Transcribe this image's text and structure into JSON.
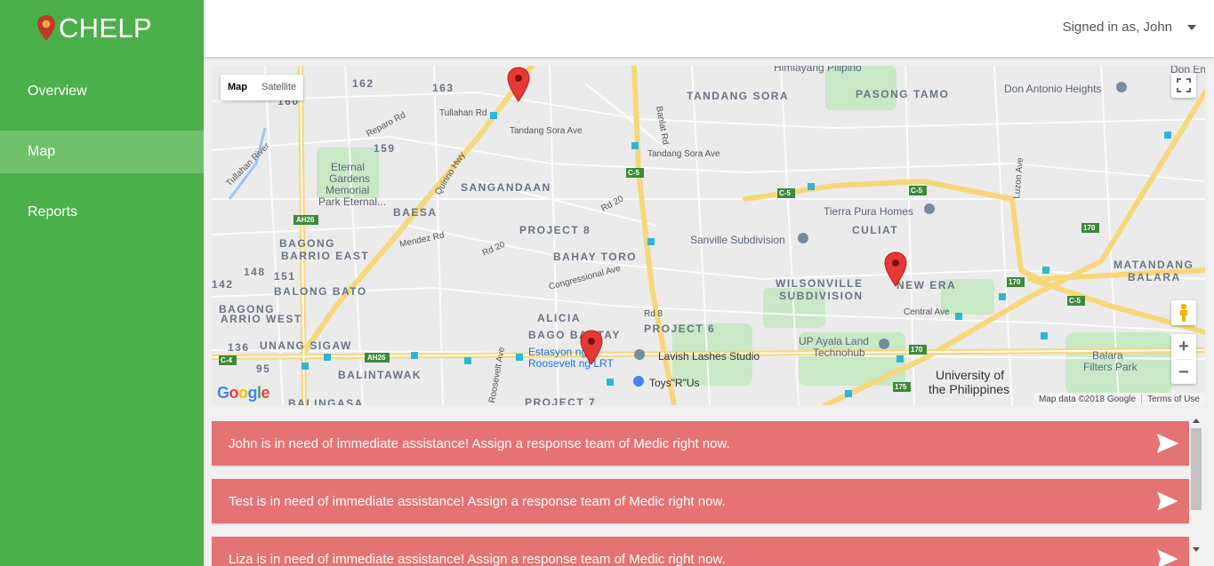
{
  "app": {
    "brand": "CHELP",
    "brand_color": "#4cb04a"
  },
  "sidebar": {
    "items": [
      {
        "label": "Overview",
        "active": false
      },
      {
        "label": "Map",
        "active": true
      },
      {
        "label": "Reports",
        "active": false
      }
    ]
  },
  "header": {
    "user_label": "Signed in as, John"
  },
  "map": {
    "type_map": "Map",
    "type_satellite": "Satellite",
    "attribution": "Map data ©2018 Google",
    "terms": "Terms of Use",
    "google_logo": "Google",
    "place_labels": [
      "162",
      "163",
      "160",
      "159",
      "148",
      "151",
      "142",
      "136",
      "95",
      "TANDANG SORA",
      "PASONG TAMO",
      "Don Antonio Heights",
      "Himlayang Pilipino",
      "Don Enriq",
      "SANGANDAAN",
      "BAESA",
      "BAGONG",
      "BARRIO EAST",
      "BALONG BATO",
      "BAGONG",
      "ARRIO WEST",
      "UNANG SIGAW",
      "BALINTAWAK",
      "BALINGASA",
      "PROJECT 8",
      "BAHAY TORO",
      "ALICIA",
      "BAGO BANTAY",
      "PROJECT 6",
      "PROJECT 7",
      "WILSONVILLE",
      "SUBDIVISION",
      "NEW ERA",
      "CULIAT",
      "Tierra Pura Homes",
      "Sanville Subdivision",
      "MATANDANG",
      "BALARA",
      "Balara",
      "Filters Park",
      "University of",
      "the Philippines",
      "UP Ayala Land",
      "Technohub",
      "Lavish Lashes Studio",
      "Toys\"R\"Us",
      "Estasyon ng",
      "Roosevelt ng LRT",
      "Eternal",
      "Gardens",
      "Memorial",
      "Park Eternal...",
      "Tullahan River",
      "Tullahan Rd",
      "Tandang Sora Ave",
      "Tandang Sora Ave",
      "Quirino Hwy",
      "Reparo Rd",
      "Mendez Rd",
      "Rd 20",
      "Rd 20",
      "Congressional Ave",
      "Rd 8",
      "Central Ave",
      "Luzon Ave",
      "Banlat Rd",
      "Roosevelt Ave"
    ],
    "road_shields": [
      "AH26",
      "AH26",
      "C-4",
      "C-5",
      "C-5",
      "C-5",
      "C-5",
      "170",
      "170",
      "170",
      "175"
    ],
    "pins": [
      {
        "name": "incident-pin-1",
        "color": "#e53935"
      },
      {
        "name": "incident-pin-2",
        "color": "#e53935"
      },
      {
        "name": "incident-pin-3",
        "color": "#e53935"
      }
    ]
  },
  "alerts": [
    {
      "message": "John is in need of immediate assistance! Assign a response team of Medic right now."
    },
    {
      "message": "Test is in need of immediate assistance! Assign a response team of Medic right now."
    },
    {
      "message": "Liza is in need of immediate assistance! Assign a response team of Medic right now."
    }
  ],
  "colors": {
    "alert_bg": "#e57373",
    "nav_active": "#6fc06b",
    "pin": "#e53935"
  }
}
